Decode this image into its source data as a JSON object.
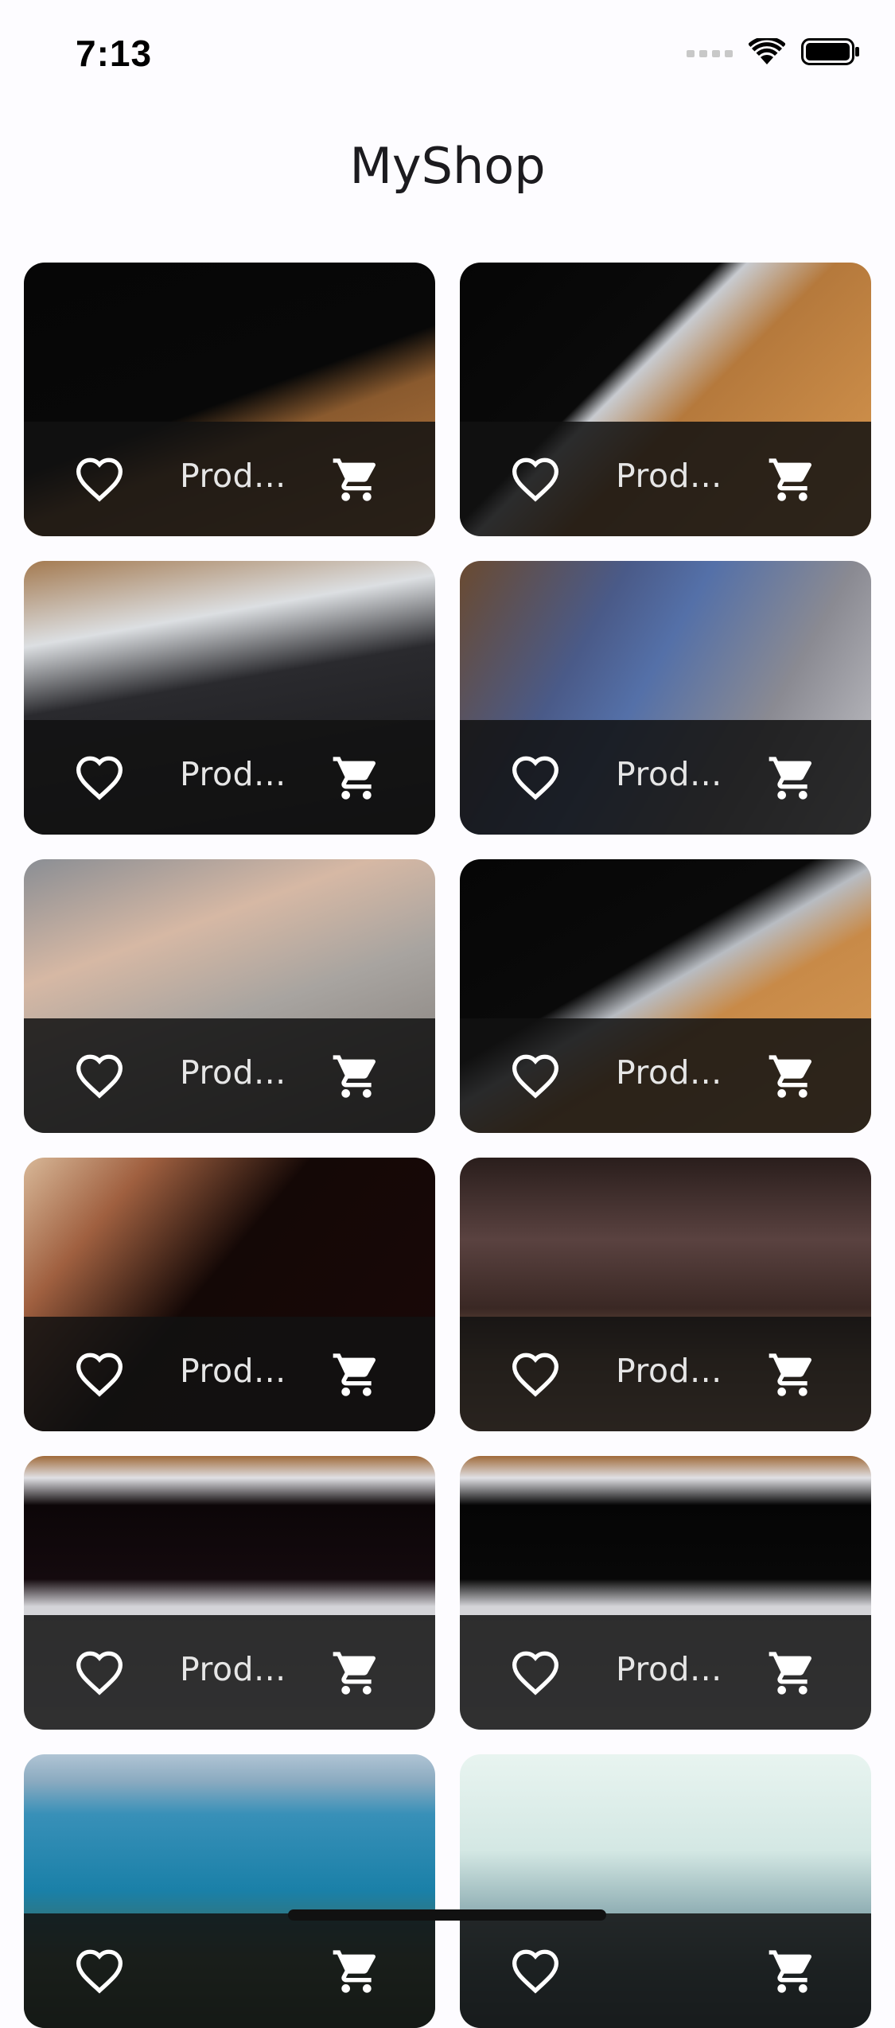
{
  "status_bar": {
    "time": "7:13"
  },
  "app_bar": {
    "title": "MyShop"
  },
  "icons": {
    "favorite": "heart-outline-icon",
    "cart": "shopping-cart-icon"
  },
  "colors": {
    "background": "#fdfcff",
    "footer_overlay": "#121212",
    "icon": "#ffffff",
    "title_text": "#e6e6e6"
  },
  "products": [
    {
      "title": "Prod...",
      "photo": "p-laptop-dark"
    },
    {
      "title": "Prod...",
      "photo": "p-laptop-wood"
    },
    {
      "title": "Prod...",
      "photo": "p-laptop-keys"
    },
    {
      "title": "Prod...",
      "photo": "p-phone"
    },
    {
      "title": "Prod...",
      "photo": "p-hand"
    },
    {
      "title": "Prod...",
      "photo": "p-laptop-table"
    },
    {
      "title": "Prod...",
      "photo": "p-laptop-lamp"
    },
    {
      "title": "Prod...",
      "photo": "p-bag"
    },
    {
      "title": "Prod...",
      "photo": "p-laptop-top"
    },
    {
      "title": "Prod...",
      "photo": "p-laptop-top2"
    },
    {
      "title": "",
      "photo": "p-lake"
    },
    {
      "title": "",
      "photo": "p-mist"
    }
  ]
}
